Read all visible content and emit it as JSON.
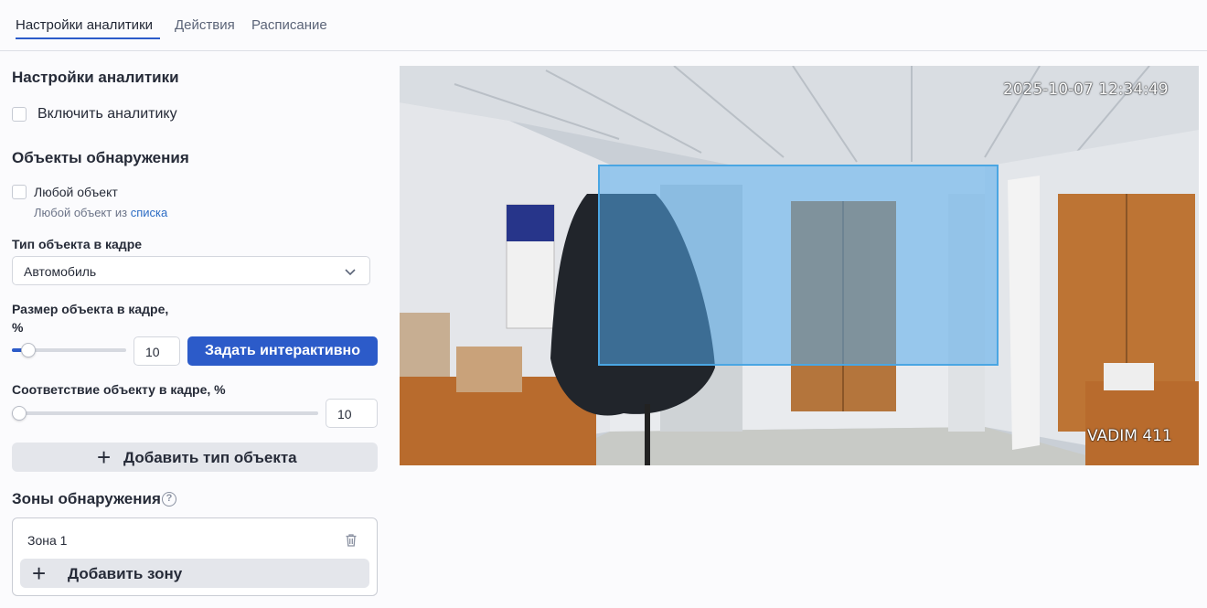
{
  "tabs": [
    {
      "label": "Настройки аналитики",
      "active": true
    },
    {
      "label": "Действия",
      "active": false
    },
    {
      "label": "Расписание",
      "active": false
    }
  ],
  "analytics": {
    "title": "Настройки аналитики",
    "enable_label": "Включить аналитику",
    "enabled": false
  },
  "objects": {
    "title": "Объекты обнаружения",
    "any_object_label": "Любой объект",
    "any_object_checked": false,
    "any_object_hint": "Любой объект из",
    "any_object_link": "списка",
    "type_label": "Тип объекта в кадре",
    "type_value": "Автомобиль",
    "size_label": "Размер объекта в кадре,",
    "size_unit": "%",
    "size_value": "10",
    "interactive_button": "Задать интерактивно",
    "match_label": "Соответствие объекту в кадре, %",
    "match_value": "10",
    "add_type_button": "Добавить тип объекта"
  },
  "zones": {
    "title": "Зоны обнаружения",
    "items": [
      {
        "label": "Зона 1"
      }
    ],
    "add_zone_button": "Добавить зону"
  },
  "camera": {
    "timestamp": "2025-10-07 12:34:49",
    "name": "VADIM 411",
    "zone_color": "#54aaeb"
  },
  "colors": {
    "accent": "#2c5bc9",
    "link": "#2c6cc4"
  }
}
